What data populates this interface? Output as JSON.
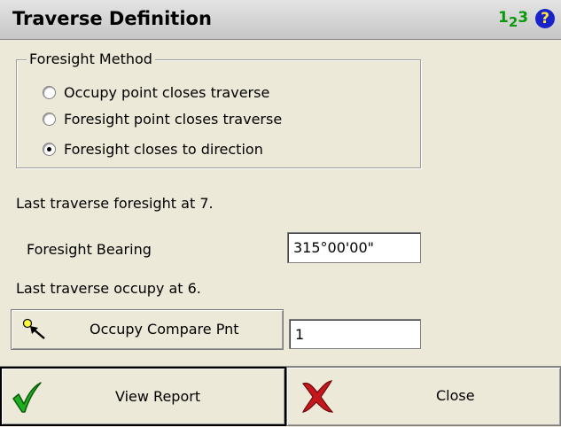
{
  "titlebar": {
    "title": "Traverse Definition",
    "numpad_icon": {
      "main": "1",
      "sub": "2",
      "tail": "3"
    },
    "help_icon": "?"
  },
  "foresight_method": {
    "legend": "Foresight Method",
    "options": [
      {
        "label": "Occupy point closes traverse",
        "checked": false
      },
      {
        "label": "Foresight point closes traverse",
        "checked": false
      },
      {
        "label": "Foresight closes to direction",
        "checked": true
      }
    ]
  },
  "info": {
    "last_foresight": "Last traverse foresight at 7.",
    "last_occupy": "Last traverse occupy at 6."
  },
  "foresight_bearing": {
    "label": "Foresight Bearing",
    "value": "315°00'00\""
  },
  "occupy_compare": {
    "button_label": "Occupy Compare Pnt",
    "value": "1"
  },
  "actions": {
    "view_report": "View Report",
    "close": "Close"
  },
  "colors": {
    "background": "#ece9d8",
    "check_green": "#1fae1f",
    "close_red": "#c4161c",
    "help_blue": "#1a22c9",
    "numpad_green": "#0b9a0b"
  }
}
